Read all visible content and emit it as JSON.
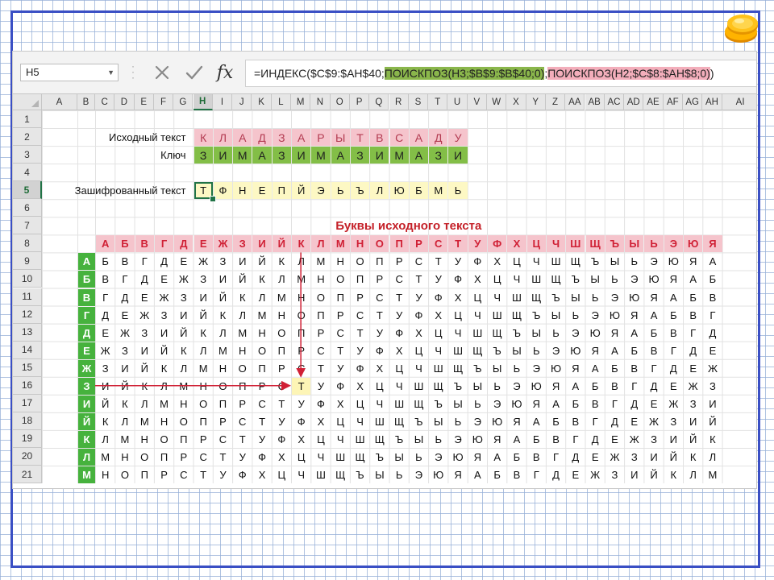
{
  "formula_bar": {
    "name_box": "H5",
    "formula": {
      "part1": "=ИНДЕКС($C$9:$AH$40;",
      "part2": "ПОИСКПОЗ(H3;$B$9:$B$40;0)",
      "part3": ";",
      "part4": "ПОИСКПОЗ(H2;$C$8:$AH$8;0)",
      "part5": ")"
    },
    "cancel_icon": "x-icon",
    "enter_icon": "check-icon",
    "fx_label": "fx"
  },
  "columns": [
    "A",
    "B",
    "C",
    "D",
    "E",
    "F",
    "G",
    "H",
    "I",
    "J",
    "K",
    "L",
    "M",
    "N",
    "O",
    "P",
    "Q",
    "R",
    "S",
    "T",
    "U",
    "V",
    "W",
    "X",
    "Y",
    "Z",
    "AA",
    "AB",
    "AC",
    "AD",
    "AE",
    "AF",
    "AG",
    "AH",
    "AI"
  ],
  "selected_column": "H",
  "rows": [
    "1",
    "2",
    "3",
    "4",
    "5",
    "6",
    "7",
    "8",
    "9",
    "10",
    "11",
    "12",
    "13",
    "14",
    "15",
    "16",
    "17",
    "18",
    "19",
    "20",
    "21"
  ],
  "selected_row": "5",
  "labels": {
    "source_text": "Исходный текст",
    "key": "Ключ",
    "encrypted_text": "Зашифрованный текст",
    "table_title": "Буквы исходного текста"
  },
  "source_text": [
    "К",
    "Л",
    "А",
    "Д",
    "З",
    "А",
    "Р",
    "Ы",
    "Т",
    "В",
    "С",
    "А",
    "Д",
    "У"
  ],
  "key": [
    "З",
    "И",
    "М",
    "А",
    "З",
    "И",
    "М",
    "А",
    "З",
    "И",
    "М",
    "А",
    "З",
    "И"
  ],
  "encrypted": [
    "Т",
    "Ф",
    "Н",
    "Е",
    "П",
    "Й",
    "Э",
    "Ь",
    "Ъ",
    "Л",
    "Ю",
    "Б",
    "М",
    "Ь"
  ],
  "alphabet_header": [
    "А",
    "Б",
    "В",
    "Г",
    "Д",
    "Е",
    "Ж",
    "З",
    "И",
    "Й",
    "К",
    "Л",
    "М",
    "Н",
    "О",
    "П",
    "Р",
    "С",
    "Т",
    "У",
    "Ф",
    "Х",
    "Ц",
    "Ч",
    "Ш",
    "Щ",
    "Ъ",
    "Ы",
    "Ь",
    "Э",
    "Ю",
    "Я"
  ],
  "key_letters": [
    "А",
    "Б",
    "В",
    "Г",
    "Д",
    "Е",
    "Ж",
    "З",
    "И",
    "Й",
    "К",
    "Л",
    "М"
  ],
  "table_rows": [
    [
      "Б",
      "В",
      "Г",
      "Д",
      "Е",
      "Ж",
      "З",
      "И",
      "Й",
      "К",
      "Л",
      "М",
      "Н",
      "О",
      "П",
      "Р",
      "С",
      "Т",
      "У",
      "Ф",
      "Х",
      "Ц",
      "Ч",
      "Ш",
      "Щ",
      "Ъ",
      "Ы",
      "Ь",
      "Э",
      "Ю",
      "Я",
      "А"
    ],
    [
      "В",
      "Г",
      "Д",
      "Е",
      "Ж",
      "З",
      "И",
      "Й",
      "К",
      "Л",
      "М",
      "Н",
      "О",
      "П",
      "Р",
      "С",
      "Т",
      "У",
      "Ф",
      "Х",
      "Ц",
      "Ч",
      "Ш",
      "Щ",
      "Ъ",
      "Ы",
      "Ь",
      "Э",
      "Ю",
      "Я",
      "А",
      "Б"
    ],
    [
      "Г",
      "Д",
      "Е",
      "Ж",
      "З",
      "И",
      "Й",
      "К",
      "Л",
      "М",
      "Н",
      "О",
      "П",
      "Р",
      "С",
      "Т",
      "У",
      "Ф",
      "Х",
      "Ц",
      "Ч",
      "Ш",
      "Щ",
      "Ъ",
      "Ы",
      "Ь",
      "Э",
      "Ю",
      "Я",
      "А",
      "Б",
      "В"
    ],
    [
      "Д",
      "Е",
      "Ж",
      "З",
      "И",
      "Й",
      "К",
      "Л",
      "М",
      "Н",
      "О",
      "П",
      "Р",
      "С",
      "Т",
      "У",
      "Ф",
      "Х",
      "Ц",
      "Ч",
      "Ш",
      "Щ",
      "Ъ",
      "Ы",
      "Ь",
      "Э",
      "Ю",
      "Я",
      "А",
      "Б",
      "В",
      "Г"
    ],
    [
      "Е",
      "Ж",
      "З",
      "И",
      "Й",
      "К",
      "Л",
      "М",
      "Н",
      "О",
      "П",
      "Р",
      "С",
      "Т",
      "У",
      "Ф",
      "Х",
      "Ц",
      "Ч",
      "Ш",
      "Щ",
      "Ъ",
      "Ы",
      "Ь",
      "Э",
      "Ю",
      "Я",
      "А",
      "Б",
      "В",
      "Г",
      "Д"
    ],
    [
      "Ж",
      "З",
      "И",
      "Й",
      "К",
      "Л",
      "М",
      "Н",
      "О",
      "П",
      "Р",
      "С",
      "Т",
      "У",
      "Ф",
      "Х",
      "Ц",
      "Ч",
      "Ш",
      "Щ",
      "Ъ",
      "Ы",
      "Ь",
      "Э",
      "Ю",
      "Я",
      "А",
      "Б",
      "В",
      "Г",
      "Д",
      "Е"
    ],
    [
      "З",
      "И",
      "Й",
      "К",
      "Л",
      "М",
      "Н",
      "О",
      "П",
      "Р",
      "С",
      "Т",
      "У",
      "Ф",
      "Х",
      "Ц",
      "Ч",
      "Ш",
      "Щ",
      "Ъ",
      "Ы",
      "Ь",
      "Э",
      "Ю",
      "Я",
      "А",
      "Б",
      "В",
      "Г",
      "Д",
      "Е",
      "Ж"
    ],
    [
      "И",
      "Й",
      "К",
      "Л",
      "М",
      "Н",
      "О",
      "П",
      "Р",
      "С",
      "Т",
      "У",
      "Ф",
      "Х",
      "Ц",
      "Ч",
      "Ш",
      "Щ",
      "Ъ",
      "Ы",
      "Ь",
      "Э",
      "Ю",
      "Я",
      "А",
      "Б",
      "В",
      "Г",
      "Д",
      "Е",
      "Ж",
      "З"
    ],
    [
      "Й",
      "К",
      "Л",
      "М",
      "Н",
      "О",
      "П",
      "Р",
      "С",
      "Т",
      "У",
      "Ф",
      "Х",
      "Ц",
      "Ч",
      "Ш",
      "Щ",
      "Ъ",
      "Ы",
      "Ь",
      "Э",
      "Ю",
      "Я",
      "А",
      "Б",
      "В",
      "Г",
      "Д",
      "Е",
      "Ж",
      "З",
      "И"
    ],
    [
      "К",
      "Л",
      "М",
      "Н",
      "О",
      "П",
      "Р",
      "С",
      "Т",
      "У",
      "Ф",
      "Х",
      "Ц",
      "Ч",
      "Ш",
      "Щ",
      "Ъ",
      "Ы",
      "Ь",
      "Э",
      "Ю",
      "Я",
      "А",
      "Б",
      "В",
      "Г",
      "Д",
      "Е",
      "Ж",
      "З",
      "И",
      "Й"
    ],
    [
      "Л",
      "М",
      "Н",
      "О",
      "П",
      "Р",
      "С",
      "Т",
      "У",
      "Ф",
      "Х",
      "Ц",
      "Ч",
      "Ш",
      "Щ",
      "Ъ",
      "Ы",
      "Ь",
      "Э",
      "Ю",
      "Я",
      "А",
      "Б",
      "В",
      "Г",
      "Д",
      "Е",
      "Ж",
      "З",
      "И",
      "Й",
      "К"
    ],
    [
      "М",
      "Н",
      "О",
      "П",
      "Р",
      "С",
      "Т",
      "У",
      "Ф",
      "Х",
      "Ц",
      "Ч",
      "Ш",
      "Щ",
      "Ъ",
      "Ы",
      "Ь",
      "Э",
      "Ю",
      "Я",
      "А",
      "Б",
      "В",
      "Г",
      "Д",
      "Е",
      "Ж",
      "З",
      "И",
      "Й",
      "К",
      "Л"
    ],
    [
      "Н",
      "О",
      "П",
      "Р",
      "С",
      "Т",
      "У",
      "Ф",
      "Х",
      "Ц",
      "Ч",
      "Ш",
      "Щ",
      "Ъ",
      "Ы",
      "Ь",
      "Э",
      "Ю",
      "Я",
      "А",
      "Б",
      "В",
      "Г",
      "Д",
      "Е",
      "Ж",
      "З",
      "И",
      "Й",
      "К",
      "Л",
      "М"
    ]
  ],
  "colors": {
    "frame_border": "#3a4fc4",
    "source_fill": "#f5c4cc",
    "source_text": "#b33b51",
    "key_fill": "#83be47",
    "encrypted_fill": "#fdf8c4",
    "header_fill": "#f5c4cc",
    "header_text": "#d02035",
    "key_col_fill": "#46b23d",
    "arrow": "#d02035",
    "excel_accent": "#217346"
  }
}
